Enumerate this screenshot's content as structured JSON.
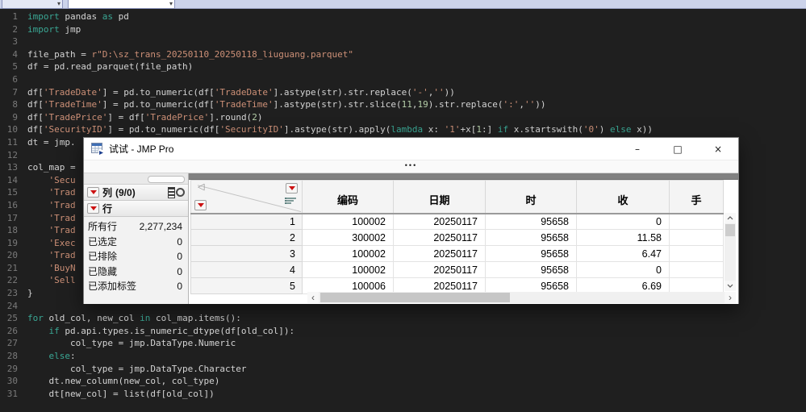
{
  "colors": {
    "editor_bg": "#1f1f1f",
    "keyword": "#3aa794",
    "string": "#cd9077",
    "number": "#b5cea8",
    "text": "#d4d4d4",
    "line_number": "#7a7a7a",
    "topbar_bg": "#ccd3ea",
    "jmp_red_triangle": "#cc1111",
    "table_band": "#818181"
  },
  "editor": {
    "lines": [
      {
        "n": 1,
        "s": [
          [
            "k",
            "import"
          ],
          [
            "t",
            " pandas "
          ],
          [
            "k",
            "as"
          ],
          [
            "t",
            " pd"
          ]
        ]
      },
      {
        "n": 2,
        "s": [
          [
            "k",
            "import"
          ],
          [
            "t",
            " jmp"
          ]
        ]
      },
      {
        "n": 3,
        "s": []
      },
      {
        "n": 4,
        "s": [
          [
            "t",
            "file_path = "
          ],
          [
            "s",
            "r\"D:\\sz_trans_20250110_20250118_liuguang.parquet\""
          ]
        ]
      },
      {
        "n": 5,
        "s": [
          [
            "t",
            "df = pd.read_parquet(file_path)"
          ]
        ]
      },
      {
        "n": 6,
        "s": []
      },
      {
        "n": 7,
        "s": [
          [
            "t",
            "df["
          ],
          [
            "s",
            "'TradeDate'"
          ],
          [
            "t",
            "] = pd.to_numeric(df["
          ],
          [
            "s",
            "'TradeDate'"
          ],
          [
            "t",
            "].astype(str).str.replace("
          ],
          [
            "s",
            "'-'"
          ],
          [
            "t",
            ","
          ],
          [
            "s",
            "''"
          ],
          [
            "t",
            "))"
          ]
        ]
      },
      {
        "n": 8,
        "s": [
          [
            "t",
            "df["
          ],
          [
            "s",
            "'TradeTime'"
          ],
          [
            "t",
            "] = pd.to_numeric(df["
          ],
          [
            "s",
            "'TradeTime'"
          ],
          [
            "t",
            "].astype(str).str.slice("
          ],
          [
            "n",
            "11"
          ],
          [
            "t",
            ","
          ],
          [
            "n",
            "19"
          ],
          [
            "t",
            ").str.replace("
          ],
          [
            "s",
            "':'"
          ],
          [
            "t",
            ","
          ],
          [
            "s",
            "''"
          ],
          [
            "t",
            "))"
          ]
        ]
      },
      {
        "n": 9,
        "s": [
          [
            "t",
            "df["
          ],
          [
            "s",
            "'TradePrice'"
          ],
          [
            "t",
            "] = df["
          ],
          [
            "s",
            "'TradePrice'"
          ],
          [
            "t",
            "].round("
          ],
          [
            "n",
            "2"
          ],
          [
            "t",
            ")"
          ]
        ]
      },
      {
        "n": 10,
        "s": [
          [
            "t",
            "df["
          ],
          [
            "s",
            "'SecurityID'"
          ],
          [
            "t",
            "] = pd.to_numeric(df["
          ],
          [
            "s",
            "'SecurityID'"
          ],
          [
            "t",
            "].astype(str).apply("
          ],
          [
            "k",
            "lambda"
          ],
          [
            "t",
            " x: "
          ],
          [
            "s",
            "'1'"
          ],
          [
            "t",
            "+x["
          ],
          [
            "n",
            "1"
          ],
          [
            "t",
            ":] "
          ],
          [
            "k",
            "if"
          ],
          [
            "t",
            " x.startswith("
          ],
          [
            "s",
            "'0'"
          ],
          [
            "t",
            ") "
          ],
          [
            "k",
            "else"
          ],
          [
            "t",
            " x))"
          ]
        ]
      },
      {
        "n": 11,
        "s": [
          [
            "t",
            "dt = jmp."
          ]
        ]
      },
      {
        "n": 12,
        "s": []
      },
      {
        "n": 13,
        "s": [
          [
            "t",
            "col_map ="
          ]
        ]
      },
      {
        "n": 14,
        "s": [
          [
            "t",
            "    "
          ],
          [
            "s",
            "'Secu"
          ]
        ]
      },
      {
        "n": 15,
        "s": [
          [
            "t",
            "    "
          ],
          [
            "s",
            "'Trad"
          ]
        ]
      },
      {
        "n": 16,
        "s": [
          [
            "t",
            "    "
          ],
          [
            "s",
            "'Trad"
          ]
        ]
      },
      {
        "n": 17,
        "s": [
          [
            "t",
            "    "
          ],
          [
            "s",
            "'Trad"
          ]
        ]
      },
      {
        "n": 18,
        "s": [
          [
            "t",
            "    "
          ],
          [
            "s",
            "'Trad"
          ]
        ]
      },
      {
        "n": 19,
        "s": [
          [
            "t",
            "    "
          ],
          [
            "s",
            "'Exec"
          ]
        ]
      },
      {
        "n": 20,
        "s": [
          [
            "t",
            "    "
          ],
          [
            "s",
            "'Trad"
          ]
        ]
      },
      {
        "n": 21,
        "s": [
          [
            "t",
            "    "
          ],
          [
            "s",
            "'BuyN"
          ]
        ]
      },
      {
        "n": 22,
        "s": [
          [
            "t",
            "    "
          ],
          [
            "s",
            "'Sell"
          ]
        ]
      },
      {
        "n": 23,
        "s": [
          [
            "t",
            "}"
          ]
        ]
      },
      {
        "n": 24,
        "s": []
      },
      {
        "n": 25,
        "s": [
          [
            "k",
            "for"
          ],
          [
            "t",
            " old_col, new_col "
          ],
          [
            "k",
            "in"
          ],
          [
            "t",
            " col_map.items():"
          ]
        ]
      },
      {
        "n": 26,
        "s": [
          [
            "t",
            "    "
          ],
          [
            "k",
            "if"
          ],
          [
            "t",
            " pd.api.types.is_numeric_dtype(df[old_col]):"
          ]
        ]
      },
      {
        "n": 27,
        "s": [
          [
            "t",
            "        col_type = jmp.DataType.Numeric"
          ]
        ]
      },
      {
        "n": 28,
        "s": [
          [
            "t",
            "    "
          ],
          [
            "k",
            "else"
          ],
          [
            "t",
            ":"
          ]
        ]
      },
      {
        "n": 29,
        "s": [
          [
            "t",
            "        col_type = jmp.DataType.Character"
          ]
        ]
      },
      {
        "n": 30,
        "s": [
          [
            "t",
            "    dt.new_column(new_col, col_type)"
          ]
        ]
      },
      {
        "n": 31,
        "s": [
          [
            "t",
            "    dt[new_col] = list(df[old_col])"
          ]
        ]
      }
    ]
  },
  "jmp": {
    "title": "试试 - JMP Pro",
    "window_controls": {
      "minimize": "–",
      "maximize": "□",
      "close": "×"
    },
    "toolbar_ellipsis": "•••",
    "columns_panel": {
      "label": "列",
      "count": "(9/0)"
    },
    "rows_panel": {
      "label": "行",
      "stats": [
        {
          "label": "所有行",
          "value": "2,277,234"
        },
        {
          "label": "已选定",
          "value": "0"
        },
        {
          "label": "已排除",
          "value": "0"
        },
        {
          "label": "已隐藏",
          "value": "0"
        },
        {
          "label": "已添加标签",
          "value": "0"
        }
      ]
    },
    "table": {
      "columns": [
        "编码",
        "日期",
        "时",
        "收",
        "手"
      ],
      "rows": [
        {
          "n": "1",
          "cells": [
            "100002",
            "20250117",
            "95658",
            "0",
            ""
          ]
        },
        {
          "n": "2",
          "cells": [
            "300002",
            "20250117",
            "95658",
            "11.58",
            ""
          ]
        },
        {
          "n": "3",
          "cells": [
            "100002",
            "20250117",
            "95658",
            "6.47",
            ""
          ]
        },
        {
          "n": "4",
          "cells": [
            "100002",
            "20250117",
            "95658",
            "0",
            ""
          ]
        },
        {
          "n": "5",
          "cells": [
            "100006",
            "20250117",
            "95658",
            "6.69",
            ""
          ]
        }
      ]
    }
  }
}
